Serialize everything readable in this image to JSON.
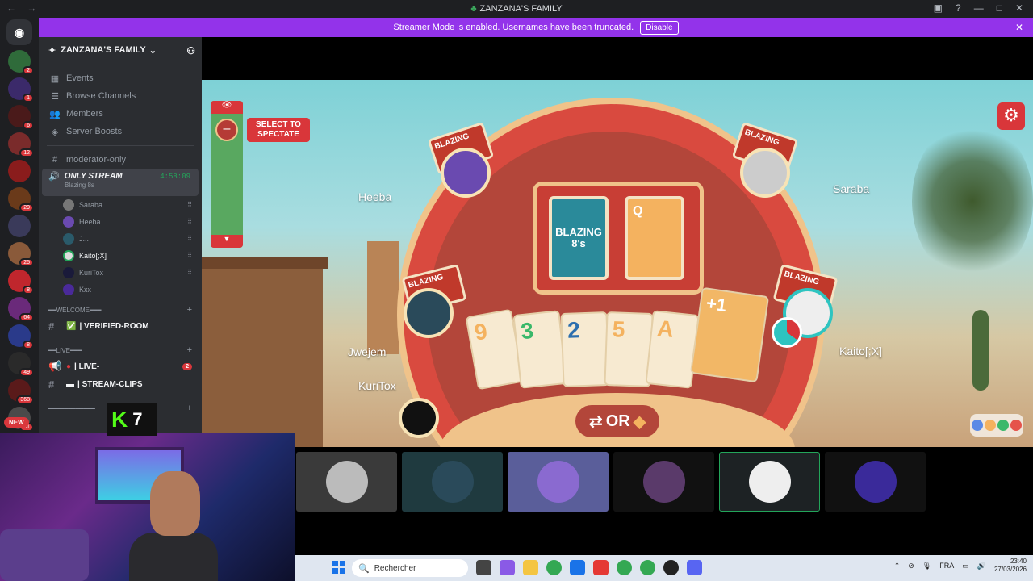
{
  "window": {
    "title": "ZANZANA'S FAMILY",
    "nav_back": "←",
    "nav_forward": "→"
  },
  "banner": {
    "text": "Streamer Mode is enabled. Usernames have been truncated.",
    "disable_label": "Disable"
  },
  "guild_badges": [
    "2",
    "1",
    "6",
    "12",
    "29",
    "25",
    "8",
    "64",
    "8",
    "49",
    "368",
    "81"
  ],
  "new_label": "NEW",
  "server": {
    "name": "ZANZANA'S FAMILY",
    "menu": [
      "Events",
      "Browse Channels",
      "Members",
      "Server Boosts"
    ],
    "moderator_channel": "moderator-only",
    "voice": {
      "name": "ONLY STREAM",
      "activity": "Blazing 8s",
      "timer": "4:58:09",
      "users": [
        "Saraba",
        "Heeba",
        "J...",
        "Kaito[;X]",
        "KuriTox",
        "Kxx"
      ]
    },
    "cat_welcome": "━━WELCOME━━━",
    "verified_room": "| VERIFIED-ROOM",
    "cat_live": "━━LIVE━━━",
    "live_channel": "| LIVE-",
    "live_badge": "2",
    "stream_clips": "| STREAM-CLIPS",
    "cat_more": "━━━━━━━━━━━━"
  },
  "game": {
    "spectate_label": "SELECT TO SPECTATE",
    "deck_label": "BLAZING 8's",
    "discard_label": "Q",
    "players": {
      "left": "Heeba",
      "right": "Saraba",
      "left_bottom": "Jwejem",
      "right_bottom": "Kaito[;X]",
      "spectator": "KuriTox"
    },
    "hand": [
      "9",
      "3",
      "2",
      "5",
      "A"
    ],
    "drawn_card": "+1",
    "or_label": "OR",
    "fan_label": "BLAZING"
  },
  "stream": {
    "k_logo": "K",
    "k_count": "7"
  },
  "taskbar": {
    "search_placeholder": "Rechercher",
    "lang": "FRA",
    "time": "23:40",
    "date": "27/03/2026"
  },
  "colors": {
    "accent": "#9333ea",
    "discord_red": "#da373c",
    "game_red": "#d9363a",
    "online_green": "#23a55a"
  }
}
